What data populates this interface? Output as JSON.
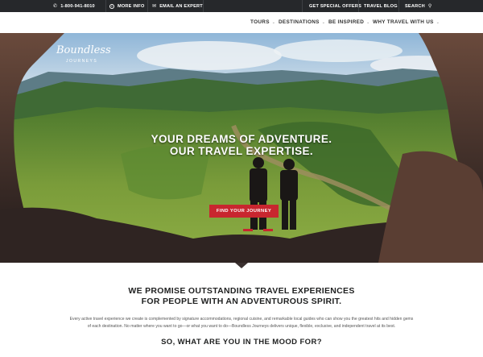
{
  "utility_bar": {
    "phone": "1-800-941-8010",
    "more_info": "MORE INFO",
    "email_expert": "EMAIL AN EXPERT",
    "special_offers": "GET SPECIAL OFFERS",
    "travel_blog": "TRAVEL BLOG",
    "search": "SEARCH"
  },
  "nav": {
    "items": [
      "TOURS",
      "DESTINATIONS",
      "BE INSPIRED",
      "WHY TRAVEL WITH US"
    ]
  },
  "logo": {
    "script": "Boundless",
    "sub": "JOURNEYS"
  },
  "hero": {
    "headline_line1": "YOUR DREAMS OF ADVENTURE.",
    "headline_line2": "OUR TRAVEL EXPERTISE.",
    "cta": "FIND YOUR JOURNEY"
  },
  "content": {
    "promise_line1": "WE PROMISE OUTSTANDING TRAVEL EXPERIENCES",
    "promise_line2": "FOR PEOPLE WITH AN ADVENTUROUS SPIRIT.",
    "body_line1": "Every active travel experience we create is complemented by signature accommodations, regional cuisine, and remarkable local guides who can show you the greatest hits and hidden gems",
    "body_line2": "of each destination. No matter where you want to go—or what you want to do—Boundless Journeys delivers unique, flexible, exclusive, and independent travel at its best.",
    "mood_heading": "SO, WHAT ARE YOU IN THE MOOD FOR?"
  },
  "colors": {
    "topbar": "#26282b",
    "cta": "#c8262f",
    "heading": "#1f2020"
  },
  "icons": [
    "phone-icon",
    "info-icon",
    "email-icon",
    "chevron-down-icon",
    "search-icon"
  ]
}
